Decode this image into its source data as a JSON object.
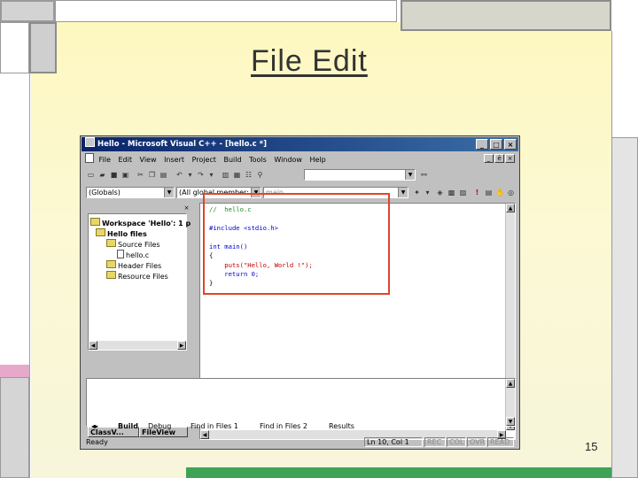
{
  "slide": {
    "title": "File Edit",
    "page_number": "15"
  },
  "window": {
    "title": "Hello - Microsoft Visual C++ - [hello.c *]",
    "title_buttons": [
      "_",
      "□",
      "×"
    ],
    "menu": [
      "File",
      "Edit",
      "View",
      "Insert",
      "Project",
      "Build",
      "Tools",
      "Window",
      "Help"
    ],
    "mdi_buttons": [
      "_",
      "ē",
      "×"
    ]
  },
  "toolbar2": {
    "globals_combo": "(Globals)",
    "members_combo": "(All global member:",
    "third_combo": "main"
  },
  "workspace": {
    "root": "Workspace 'Hello': 1 p",
    "project": "Hello files",
    "source_folder": "Source Files",
    "source_file": "hello.c",
    "header_folder": "Header Files",
    "resource_folder": "Resource Files",
    "tabs": [
      "ClassV...",
      "FileView"
    ]
  },
  "editor": {
    "lines": [
      {
        "text": "//  hello.c",
        "kind": "comment"
      },
      {
        "text": "#include <stdio.h>",
        "kind": "kw"
      },
      {
        "text": "int main()",
        "kind": "kw"
      },
      {
        "text": "{",
        "kind": "plain"
      },
      {
        "text": "    puts(\"Hello, World !\");",
        "kind": "str"
      },
      {
        "text": "    return 0;",
        "kind": "kw"
      },
      {
        "text": "}",
        "kind": "plain"
      }
    ]
  },
  "output": {
    "tabs": [
      "Build",
      "Debug",
      "Find in Files 1",
      "Find in Files 2",
      "Results"
    ]
  },
  "status": {
    "ready": "Ready",
    "position": "Ln 10, Col 1",
    "indicators": [
      "REC",
      "COL",
      "OVR",
      "READ"
    ]
  },
  "colors": {
    "title_gradient_start": "#0a246a",
    "highlight_box": "#e0452c",
    "slide_background": "#fcf9d4"
  }
}
